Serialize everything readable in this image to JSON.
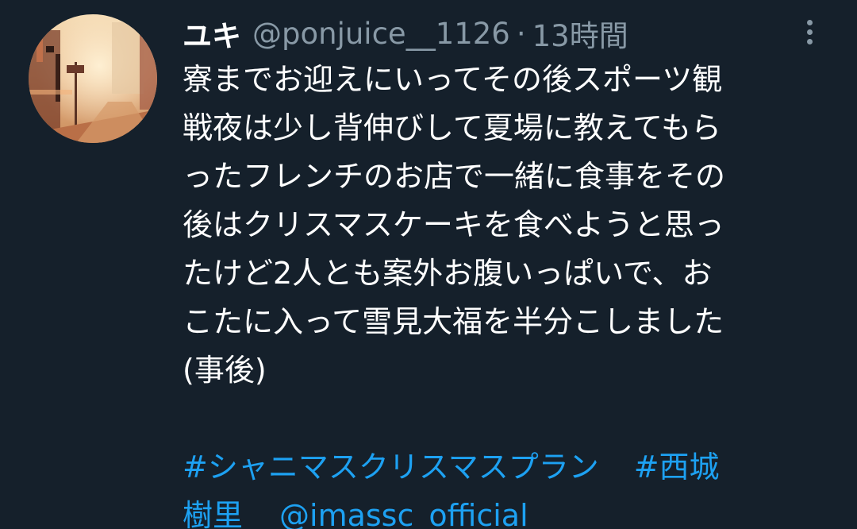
{
  "user": {
    "display_name": "ユキ",
    "handle": "@ponjuice__1126",
    "separator": "·",
    "time": "13時間"
  },
  "tweet": {
    "lines": [
      "寮までお迎えにいってその後スポーツ観",
      "戦夜は少し背伸びして夏場に教えてもら",
      "ったフレンチのお店で一緒に食事をその",
      "後はクリスマスケーキを食べようと思っ",
      "たけど2人とも案外お腹いっぱいで、お",
      "こたに入って雪見大福を半分こしました",
      "(事後)"
    ],
    "hashtag1": "#シャニマスクリスマスプラン",
    "hashtag2_part1": "#西城",
    "hashtag2_part2": "樹里",
    "mention": "@imassc_official"
  },
  "colors": {
    "background": "#15202b",
    "text": "#ffffff",
    "muted": "#8899a6",
    "link": "#1da1f2"
  },
  "icons": {
    "more": "more-vertical-icon",
    "avatar": "avatar-image"
  }
}
